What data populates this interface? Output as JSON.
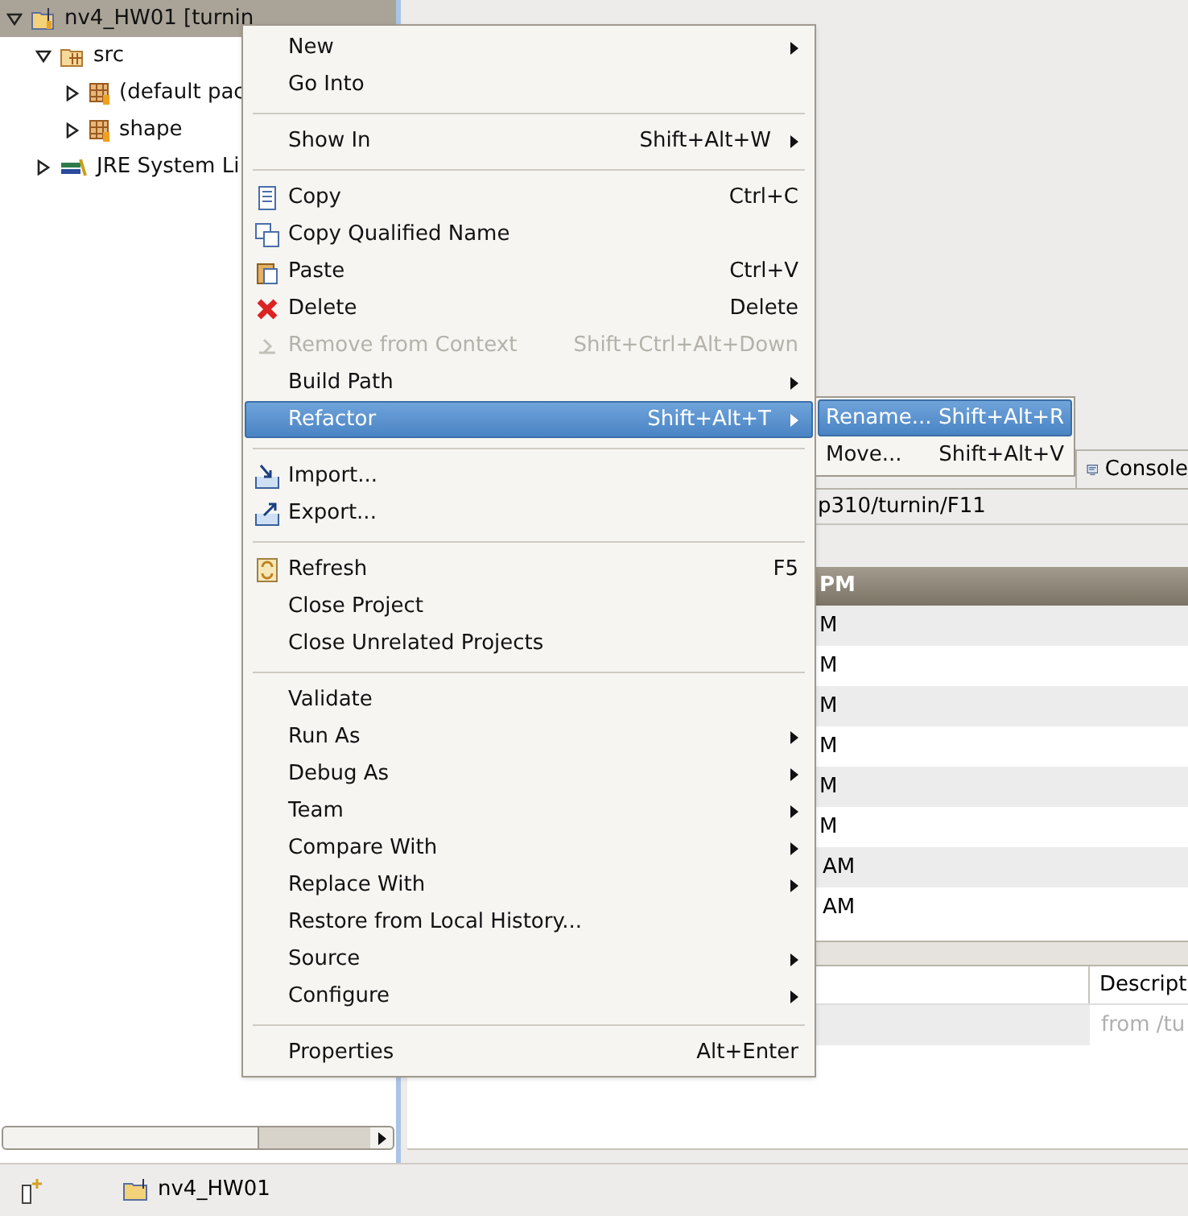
{
  "tree": [
    {
      "label": "nv4_HW01 [turnin",
      "expanded": true,
      "selected": true,
      "children": [
        {
          "label": "src",
          "expanded": true,
          "selected": false,
          "children": [
            {
              "label": "(default pac",
              "expanded": false,
              "selected": false
            },
            {
              "label": "shape",
              "expanded": false,
              "selected": false
            }
          ]
        },
        {
          "label": "JRE System Li",
          "expanded": false,
          "selected": false
        }
      ]
    }
  ],
  "tabs": [
    {
      "label": "Console",
      "selected": false
    }
  ],
  "path": "p310/turnin/F11",
  "table": {
    "header": "PM",
    "rows": [
      "M",
      "M",
      "M",
      "M",
      "M",
      "M",
      "AM",
      "AM"
    ]
  },
  "problems": {
    "columns": [
      "Descript"
    ],
    "rows": [
      "from /tu"
    ]
  },
  "status_bar": {
    "project": "nv4_HW01"
  },
  "context_menu": {
    "groups": [
      [
        {
          "label": "New",
          "submenu": true,
          "disabled": false,
          "selected": false
        },
        {
          "label": "Go Into",
          "submenu": false,
          "disabled": false,
          "selected": false
        }
      ],
      [
        {
          "label": "Show In",
          "shortcut": "Shift+Alt+W",
          "submenu": true,
          "disabled": false,
          "selected": false
        }
      ],
      [
        {
          "label": "Copy",
          "shortcut": "Ctrl+C",
          "submenu": false,
          "disabled": false,
          "selected": false
        },
        {
          "label": "Copy Qualified Name",
          "submenu": false,
          "disabled": false,
          "selected": false
        },
        {
          "label": "Paste",
          "shortcut": "Ctrl+V",
          "submenu": false,
          "disabled": false,
          "selected": false
        },
        {
          "label": "Delete",
          "shortcut": "Delete",
          "submenu": false,
          "disabled": false,
          "selected": false
        },
        {
          "label": "Remove from Context",
          "shortcut": "Shift+Ctrl+Alt+Down",
          "submenu": false,
          "disabled": true,
          "selected": false
        },
        {
          "label": "Build Path",
          "submenu": true,
          "disabled": false,
          "selected": false
        },
        {
          "label": "Refactor",
          "shortcut": "Shift+Alt+T",
          "submenu": true,
          "disabled": false,
          "selected": true
        }
      ],
      [
        {
          "label": "Import...",
          "submenu": false,
          "disabled": false,
          "selected": false
        },
        {
          "label": "Export...",
          "submenu": false,
          "disabled": false,
          "selected": false
        }
      ],
      [
        {
          "label": "Refresh",
          "shortcut": "F5",
          "submenu": false,
          "disabled": false,
          "selected": false
        },
        {
          "label": "Close Project",
          "submenu": false,
          "disabled": false,
          "selected": false
        },
        {
          "label": "Close Unrelated Projects",
          "submenu": false,
          "disabled": false,
          "selected": false
        }
      ],
      [
        {
          "label": "Validate",
          "submenu": false,
          "disabled": false,
          "selected": false
        },
        {
          "label": "Run As",
          "submenu": true,
          "disabled": false,
          "selected": false
        },
        {
          "label": "Debug As",
          "submenu": true,
          "disabled": false,
          "selected": false
        },
        {
          "label": "Team",
          "submenu": true,
          "disabled": false,
          "selected": false
        },
        {
          "label": "Compare With",
          "submenu": true,
          "disabled": false,
          "selected": false
        },
        {
          "label": "Replace With",
          "submenu": true,
          "disabled": false,
          "selected": false
        },
        {
          "label": "Restore from Local History...",
          "submenu": false,
          "disabled": false,
          "selected": false
        },
        {
          "label": "Source",
          "submenu": true,
          "disabled": false,
          "selected": false
        },
        {
          "label": "Configure",
          "submenu": true,
          "disabled": false,
          "selected": false
        }
      ],
      [
        {
          "label": "Properties",
          "shortcut": "Alt+Enter",
          "submenu": false,
          "disabled": false,
          "selected": false
        }
      ]
    ]
  },
  "submenu": {
    "items": [
      {
        "label": "Rename...",
        "shortcut": "Shift+Alt+R",
        "selected": true
      },
      {
        "label": "Move...",
        "shortcut": "Shift+Alt+V",
        "selected": false
      }
    ]
  }
}
